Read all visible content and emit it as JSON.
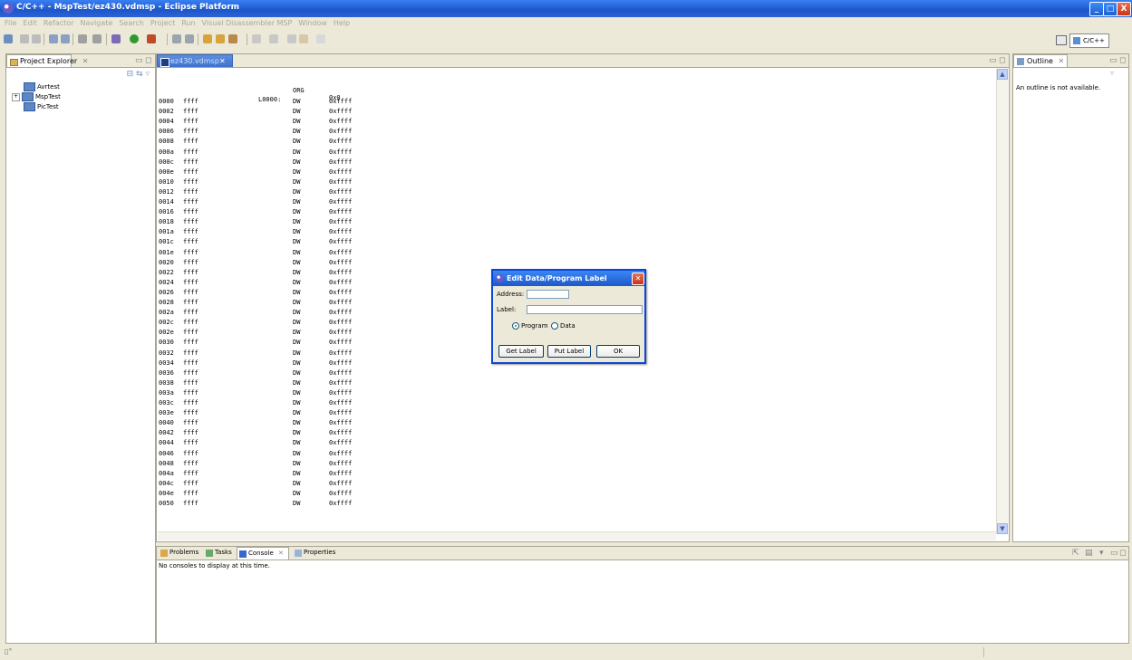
{
  "window": {
    "title": "C/C++ - MspTest/ez430.vdmsp - Eclipse Platform",
    "controls": [
      "_",
      "□",
      "X"
    ]
  },
  "menu": [
    "File",
    "Edit",
    "Refactor",
    "Navigate",
    "Search",
    "Project",
    "Run",
    "Visual Disassembler MSP",
    "Window",
    "Help"
  ],
  "perspective": {
    "label": "C/C++"
  },
  "project_explorer": {
    "tab": "Project Explorer",
    "items": [
      {
        "label": "Avrtest",
        "expandable": false
      },
      {
        "label": "MspTest",
        "expandable": true
      },
      {
        "label": "PicTest",
        "expandable": false
      }
    ]
  },
  "editor": {
    "tab": "ez430.vdmsp",
    "org_line": {
      "op": "ORG",
      "value": "0x0"
    },
    "label": "L0000:",
    "lines": [
      {
        "addr": "0000",
        "word": "ffff",
        "op": "DW",
        "val": "0xffff"
      },
      {
        "addr": "0002",
        "word": "ffff",
        "op": "DW",
        "val": "0xffff"
      },
      {
        "addr": "0004",
        "word": "ffff",
        "op": "DW",
        "val": "0xffff"
      },
      {
        "addr": "0006",
        "word": "ffff",
        "op": "DW",
        "val": "0xffff"
      },
      {
        "addr": "0008",
        "word": "ffff",
        "op": "DW",
        "val": "0xffff"
      },
      {
        "addr": "000a",
        "word": "ffff",
        "op": "DW",
        "val": "0xffff"
      },
      {
        "addr": "000c",
        "word": "ffff",
        "op": "DW",
        "val": "0xffff"
      },
      {
        "addr": "000e",
        "word": "ffff",
        "op": "DW",
        "val": "0xffff"
      },
      {
        "addr": "0010",
        "word": "ffff",
        "op": "DW",
        "val": "0xffff"
      },
      {
        "addr": "0012",
        "word": "ffff",
        "op": "DW",
        "val": "0xffff"
      },
      {
        "addr": "0014",
        "word": "ffff",
        "op": "DW",
        "val": "0xffff"
      },
      {
        "addr": "0016",
        "word": "ffff",
        "op": "DW",
        "val": "0xffff"
      },
      {
        "addr": "0018",
        "word": "ffff",
        "op": "DW",
        "val": "0xffff"
      },
      {
        "addr": "001a",
        "word": "ffff",
        "op": "DW",
        "val": "0xffff"
      },
      {
        "addr": "001c",
        "word": "ffff",
        "op": "DW",
        "val": "0xffff"
      },
      {
        "addr": "001e",
        "word": "ffff",
        "op": "DW",
        "val": "0xffff"
      },
      {
        "addr": "0020",
        "word": "ffff",
        "op": "DW",
        "val": "0xffff"
      },
      {
        "addr": "0022",
        "word": "ffff",
        "op": "DW",
        "val": "0xffff"
      },
      {
        "addr": "0024",
        "word": "ffff",
        "op": "DW",
        "val": "0xffff"
      },
      {
        "addr": "0026",
        "word": "ffff",
        "op": "DW",
        "val": "0xffff"
      },
      {
        "addr": "0028",
        "word": "ffff",
        "op": "DW",
        "val": "0xffff"
      },
      {
        "addr": "002a",
        "word": "ffff",
        "op": "DW",
        "val": "0xffff"
      },
      {
        "addr": "002c",
        "word": "ffff",
        "op": "DW",
        "val": "0xffff"
      },
      {
        "addr": "002e",
        "word": "ffff",
        "op": "DW",
        "val": "0xffff"
      },
      {
        "addr": "0030",
        "word": "ffff",
        "op": "DW",
        "val": "0xffff"
      },
      {
        "addr": "0032",
        "word": "ffff",
        "op": "DW",
        "val": "0xffff"
      },
      {
        "addr": "0034",
        "word": "ffff",
        "op": "DW",
        "val": "0xffff"
      },
      {
        "addr": "0036",
        "word": "ffff",
        "op": "DW",
        "val": "0xffff"
      },
      {
        "addr": "0038",
        "word": "ffff",
        "op": "DW",
        "val": "0xffff"
      },
      {
        "addr": "003a",
        "word": "ffff",
        "op": "DW",
        "val": "0xffff"
      },
      {
        "addr": "003c",
        "word": "ffff",
        "op": "DW",
        "val": "0xffff"
      },
      {
        "addr": "003e",
        "word": "ffff",
        "op": "DW",
        "val": "0xffff"
      },
      {
        "addr": "0040",
        "word": "ffff",
        "op": "DW",
        "val": "0xffff"
      },
      {
        "addr": "0042",
        "word": "ffff",
        "op": "DW",
        "val": "0xffff"
      },
      {
        "addr": "0044",
        "word": "ffff",
        "op": "DW",
        "val": "0xffff"
      },
      {
        "addr": "0046",
        "word": "ffff",
        "op": "DW",
        "val": "0xffff"
      },
      {
        "addr": "0048",
        "word": "ffff",
        "op": "DW",
        "val": "0xffff"
      },
      {
        "addr": "004a",
        "word": "ffff",
        "op": "DW",
        "val": "0xffff"
      },
      {
        "addr": "004c",
        "word": "ffff",
        "op": "DW",
        "val": "0xffff"
      },
      {
        "addr": "004e",
        "word": "ffff",
        "op": "DW",
        "val": "0xffff"
      },
      {
        "addr": "0050",
        "word": "ffff",
        "op": "DW",
        "val": "0xffff"
      }
    ]
  },
  "outline": {
    "tab": "Outline",
    "message": "An outline is not available."
  },
  "console": {
    "tabs": [
      "Problems",
      "Tasks",
      "Console",
      "Properties"
    ],
    "message": "No consoles to display at this time."
  },
  "dialog": {
    "title": "Edit Data/Program Label",
    "address_label": "Address:",
    "address_value": "",
    "label_label": "Label:",
    "label_value": "",
    "radio_program": "Program",
    "radio_data": "Data",
    "selected": "Program",
    "buttons": {
      "get": "Get Label",
      "put": "Put Label",
      "ok": "OK"
    }
  },
  "colors": {
    "titlebar": "#2563d6",
    "chrome": "#ece9d8",
    "active_tab": "#3f72cc"
  }
}
